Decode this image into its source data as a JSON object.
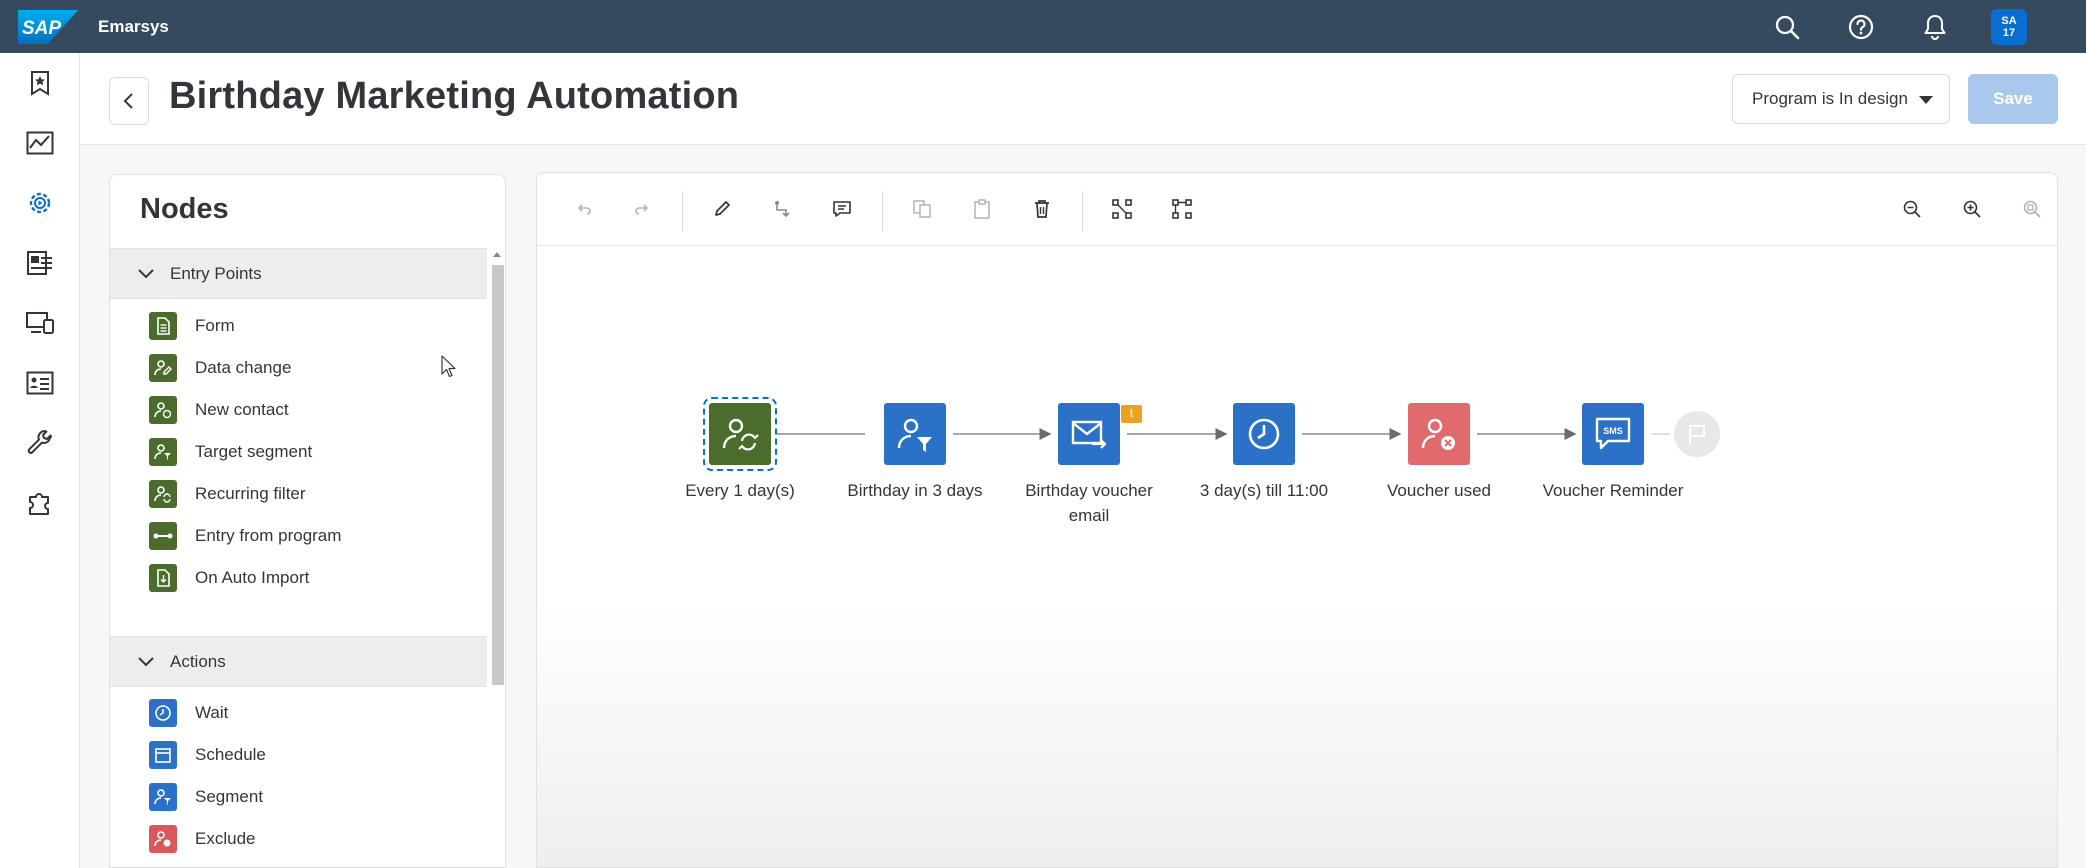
{
  "shell": {
    "logo_text": "SAP",
    "product_name": "Emarsys",
    "avatar_line1": "SA",
    "avatar_line2": "17"
  },
  "leftnav": {
    "items": [
      "bookmark-star-icon",
      "analytics-icon",
      "automation-settings-icon",
      "content-icon",
      "devices-icon",
      "contact-list-icon",
      "wrench-icon",
      "puzzle-icon"
    ],
    "active_index": 2
  },
  "header": {
    "title": "Birthday Marketing Automation",
    "status_value": "Program is In design",
    "save_label": "Save"
  },
  "nodes_panel": {
    "title": "Nodes",
    "groups": [
      {
        "label": "Entry Points",
        "items": [
          {
            "label": "Form",
            "icon": "form-icon",
            "color": "#4b6c2c"
          },
          {
            "label": "Data change",
            "icon": "data-change-icon",
            "color": "#4b6c2c"
          },
          {
            "label": "New contact",
            "icon": "new-contact-icon",
            "color": "#4b6c2c"
          },
          {
            "label": "Target segment",
            "icon": "target-segment-icon",
            "color": "#4b6c2c"
          },
          {
            "label": "Recurring filter",
            "icon": "recurring-filter-icon",
            "color": "#4b6c2c"
          },
          {
            "label": "Entry from program",
            "icon": "entry-from-program-icon",
            "color": "#4b6c2c"
          },
          {
            "label": "On Auto Import",
            "icon": "auto-import-icon",
            "color": "#4b6c2c"
          }
        ]
      },
      {
        "label": "Actions",
        "items": [
          {
            "label": "Wait",
            "icon": "clock-icon",
            "color": "#2b71c7"
          },
          {
            "label": "Schedule",
            "icon": "calendar-icon",
            "color": "#2b71c7"
          },
          {
            "label": "Segment",
            "icon": "segment-icon",
            "color": "#2b71c7"
          },
          {
            "label": "Exclude",
            "icon": "exclude-icon",
            "color": "#d9585a"
          }
        ]
      }
    ]
  },
  "canvas": {
    "toolbar": [
      "undo-icon",
      "redo-icon",
      "edit-icon",
      "connect-icon",
      "comment-icon",
      "copy-icon",
      "paste-icon",
      "delete-icon",
      "fit-icon",
      "arrange-icon",
      "zoom-out-icon",
      "zoom-in-icon",
      "zoom-reset-icon"
    ],
    "flow": [
      {
        "label": "Every 1 day(s)",
        "icon": "recurring-filter-icon",
        "color": "#4b6c2c",
        "selected": true
      },
      {
        "label": "Birthday in 3 days",
        "icon": "segment-icon",
        "color": "#2b71c7"
      },
      {
        "label": "Birthday voucher email",
        "icon": "email-icon",
        "color": "#2b71c7",
        "warning": "!"
      },
      {
        "label": "3 day(s) till 11:00",
        "icon": "clock-icon",
        "color": "#2b71c7"
      },
      {
        "label": "Voucher used",
        "icon": "exclude-icon",
        "color": "#e06b6d"
      },
      {
        "label": "Voucher Reminder",
        "icon": "sms-icon",
        "color": "#2b71c7",
        "sms_text": "SMS"
      }
    ],
    "end_node": "flag-icon"
  }
}
